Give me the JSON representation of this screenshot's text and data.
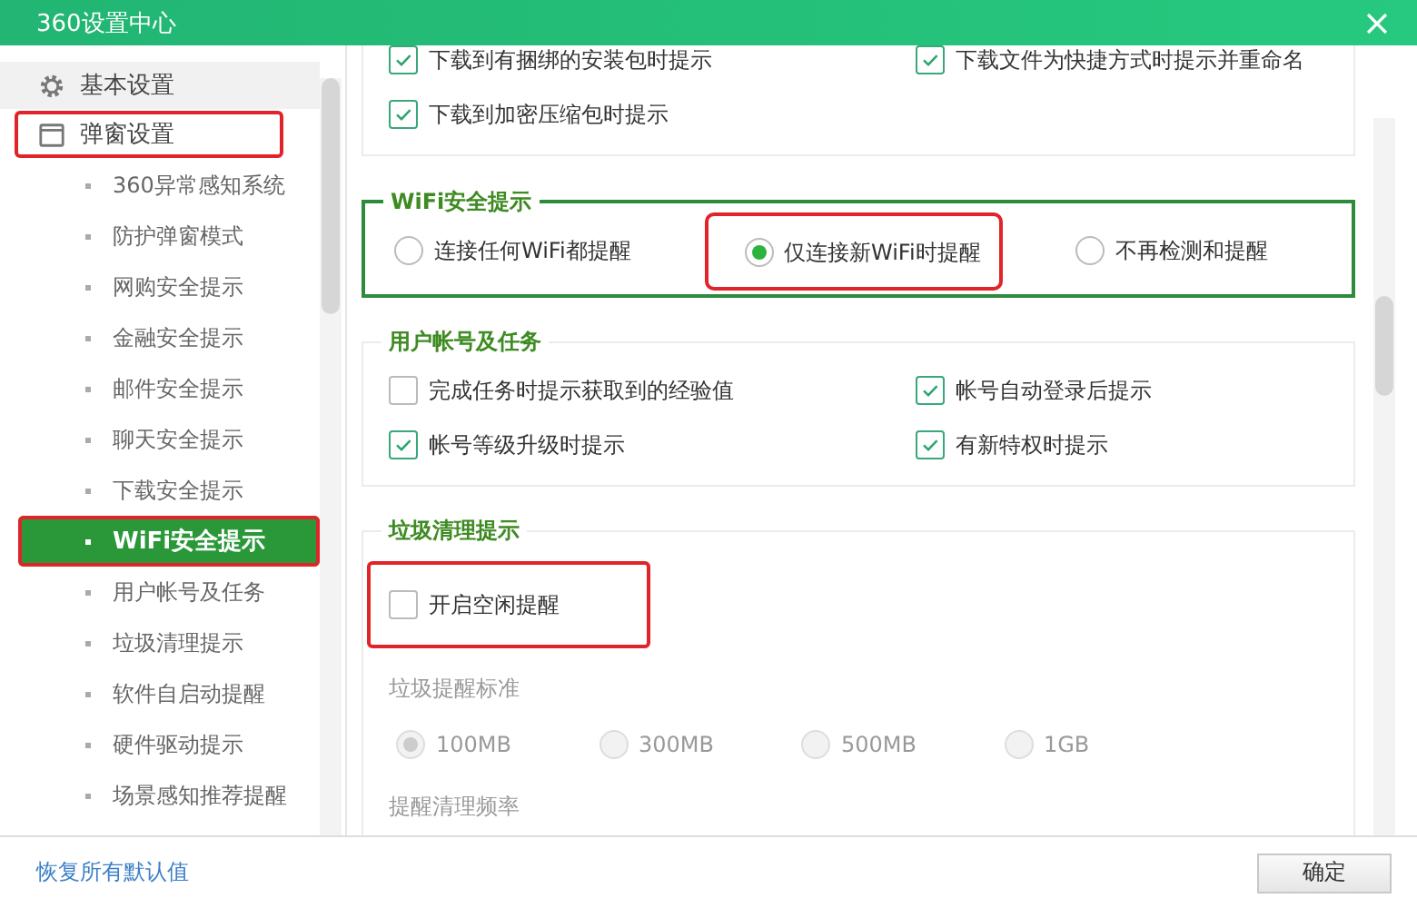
{
  "window": {
    "title": "360设置中心"
  },
  "sidebar": {
    "items": [
      {
        "label": "基本设置",
        "highlighted": false
      },
      {
        "label": "弹窗设置",
        "highlighted": true,
        "children": [
          {
            "label": "360异常感知系统",
            "selected": false,
            "highlighted": false
          },
          {
            "label": "防护弹窗模式",
            "selected": false,
            "highlighted": false
          },
          {
            "label": "网购安全提示",
            "selected": false,
            "highlighted": false
          },
          {
            "label": "金融安全提示",
            "selected": false,
            "highlighted": false
          },
          {
            "label": "邮件安全提示",
            "selected": false,
            "highlighted": false
          },
          {
            "label": "聊天安全提示",
            "selected": false,
            "highlighted": false
          },
          {
            "label": "下载安全提示",
            "selected": false,
            "highlighted": false
          },
          {
            "label": "WiFi安全提示",
            "selected": true,
            "highlighted": true
          },
          {
            "label": "用户帐号及任务",
            "selected": false,
            "highlighted": false
          },
          {
            "label": "垃圾清理提示",
            "selected": false,
            "highlighted": false
          },
          {
            "label": "软件自启动提醒",
            "selected": false,
            "highlighted": false
          },
          {
            "label": "硬件驱动提示",
            "selected": false,
            "highlighted": false
          },
          {
            "label": "场景感知推荐提醒",
            "selected": false,
            "highlighted": false
          }
        ]
      }
    ]
  },
  "sections": [
    {
      "emphasized": false,
      "rows": [
        {
          "kind": "checkbox",
          "label": "下载到有捆绑的安装包时提示",
          "checked": true,
          "highlighted": false
        },
        {
          "kind": "checkbox",
          "label": "下载文件为快捷方式时提示并重命名",
          "checked": true,
          "highlighted": false
        },
        {
          "kind": "checkbox",
          "label": "下载到加密压缩包时提示",
          "checked": true,
          "highlighted": false
        }
      ]
    },
    {
      "title": "WiFi安全提示",
      "emphasized": true,
      "rows": [
        {
          "kind": "radios",
          "disabled": false,
          "options": [
            {
              "label": "连接任何WiFi都提醒",
              "selected": false,
              "highlighted": false
            },
            {
              "label": "仅连接新WiFi时提醒",
              "selected": true,
              "highlighted": true
            },
            {
              "label": "不再检测和提醒",
              "selected": false,
              "highlighted": false
            }
          ]
        }
      ]
    },
    {
      "title": "用户帐号及任务",
      "emphasized": false,
      "rows": [
        {
          "kind": "checkbox",
          "label": "完成任务时提示获取到的经验值",
          "checked": false,
          "highlighted": false
        },
        {
          "kind": "checkbox",
          "label": "帐号自动登录后提示",
          "checked": true,
          "highlighted": false
        },
        {
          "kind": "checkbox",
          "label": "帐号等级升级时提示",
          "checked": true,
          "highlighted": false
        },
        {
          "kind": "checkbox",
          "label": "有新特权时提示",
          "checked": true,
          "highlighted": false
        }
      ]
    },
    {
      "title": "垃圾清理提示",
      "emphasized": false,
      "rows": [
        {
          "kind": "checkbox",
          "label": "开启空闲提醒",
          "checked": false,
          "highlighted": true
        },
        {
          "kind": "caption",
          "text": "垃圾提醒标准"
        },
        {
          "kind": "radios",
          "disabled": true,
          "options": [
            {
              "label": "100MB",
              "selected": true,
              "highlighted": false
            },
            {
              "label": "300MB",
              "selected": false,
              "highlighted": false
            },
            {
              "label": "500MB",
              "selected": false,
              "highlighted": false
            },
            {
              "label": "1GB",
              "selected": false,
              "highlighted": false
            }
          ]
        },
        {
          "kind": "caption",
          "text": "提醒清理频率"
        }
      ]
    }
  ],
  "footer": {
    "link": "恢复所有默认值",
    "button": "确定"
  }
}
